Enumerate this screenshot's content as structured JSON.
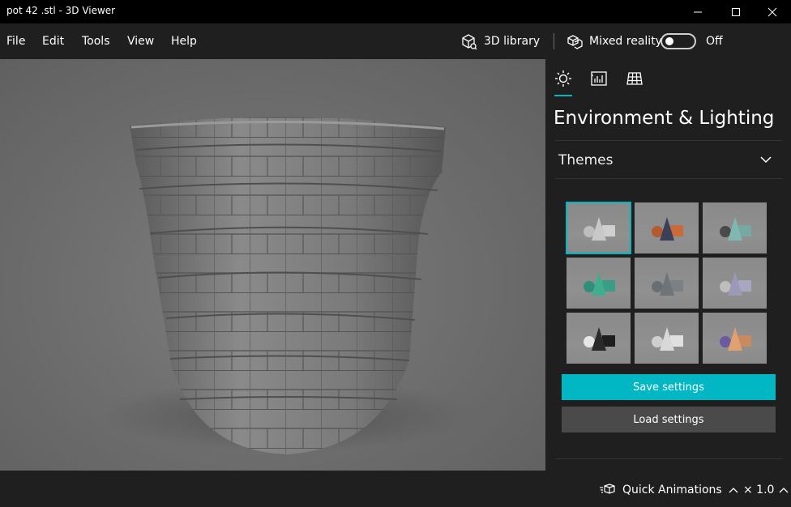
{
  "window": {
    "title": "pot 42 .stl - 3D Viewer"
  },
  "menu": {
    "items": [
      "File",
      "Edit",
      "Tools",
      "View",
      "Help"
    ]
  },
  "toolbar": {
    "library_label": "3D library",
    "mixed_reality_label": "Mixed reality",
    "mixed_reality_state": "Off",
    "mixed_reality_on": false
  },
  "panel": {
    "title": "Environment & Lighting",
    "tabs": [
      "lighting-icon",
      "stats-icon",
      "grid-icon"
    ],
    "active_tab": 0,
    "themes_label": "Themes",
    "themes_selected": 0,
    "save_label": "Save settings",
    "load_label": "Load settings"
  },
  "themes": [
    {
      "bg": "#8a8a8a",
      "cone": "#c8c8c8",
      "cube": "#cfcfcf",
      "sphere": "#bdbdbd"
    },
    {
      "bg": "#8c8c8c",
      "cone": "#3a3f5a",
      "cube": "#c86a3a",
      "sphere": "#b35a2e"
    },
    {
      "bg": "#8a8a8a",
      "cone": "#7fb8b0",
      "cube": "#78a8a2",
      "sphere": "#4a4a4a"
    },
    {
      "bg": "#898989",
      "cone": "#3fae8e",
      "cube": "#3a9e86",
      "sphere": "#2f8f7a"
    },
    {
      "bg": "#8a8a8a",
      "cone": "#6e7478",
      "cube": "#7a8084",
      "sphere": "#686e72"
    },
    {
      "bg": "#8b8b8b",
      "cone": "#9a9ab8",
      "cube": "#a7a7bf",
      "sphere": "#bdbdbd"
    },
    {
      "bg": "#8a8a8a",
      "cone": "#2a2a2a",
      "cube": "#1e1e1e",
      "sphere": "#e6e6e6"
    },
    {
      "bg": "#8b8b8b",
      "cone": "#d8d8d8",
      "cube": "#e0e0e0",
      "sphere": "#cfcfcf"
    },
    {
      "bg": "#8a8a8a",
      "cone": "#e0a070",
      "cube": "#c88a60",
      "sphere": "#6a5aa0"
    }
  ],
  "status": {
    "quick_animations_label": "Quick Animations",
    "speed_label": "× 1.0"
  },
  "colors": {
    "accent": "#00b7c3",
    "background": "#1f1f1f",
    "titlebar": "#000000"
  }
}
